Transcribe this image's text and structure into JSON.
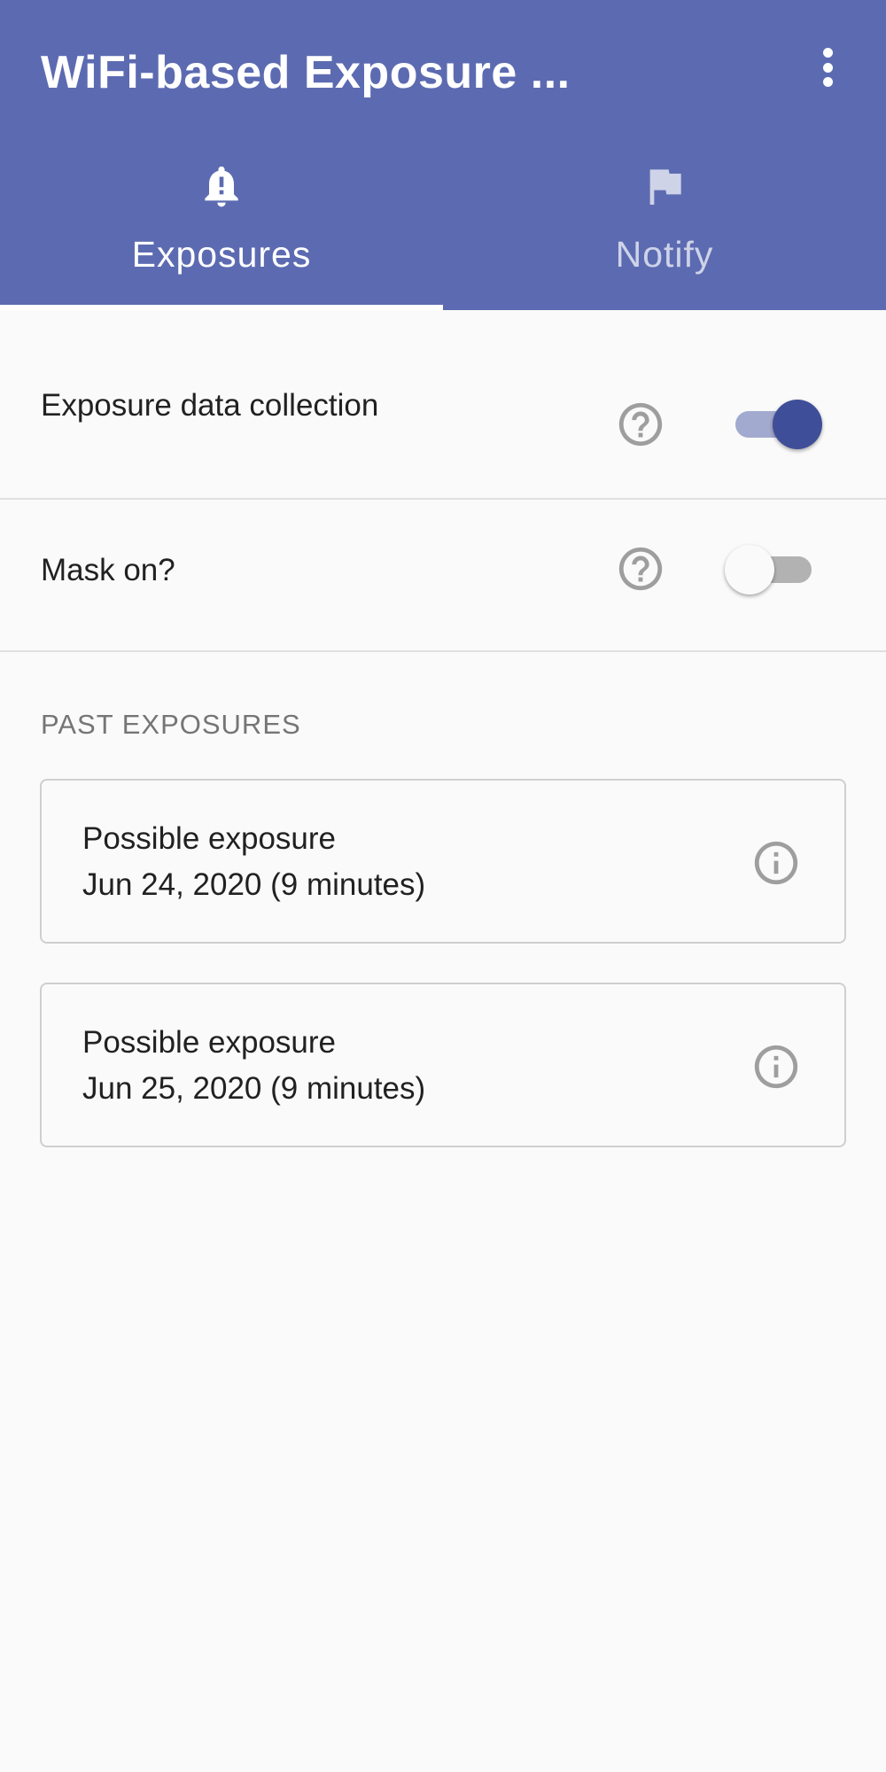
{
  "app_bar": {
    "title": "WiFi-based Exposure ...",
    "background_color": "#5c6bb1",
    "overflow_icon": "more-vert-icon"
  },
  "tabs": [
    {
      "label": "Exposures",
      "icon": "bell-alert-icon",
      "selected": true
    },
    {
      "label": "Notify",
      "icon": "flag-icon",
      "selected": false
    }
  ],
  "settings": {
    "collection": {
      "label": "Exposure data collection",
      "help_icon": "help-circle-icon",
      "enabled": true
    },
    "mask": {
      "label": "Mask on?",
      "help_icon": "help-circle-icon",
      "enabled": false
    }
  },
  "past_exposures": {
    "header": "PAST EXPOSURES",
    "items": [
      {
        "title": "Possible exposure",
        "date": "Jun 24, 2020 (9 minutes)",
        "icon": "info-icon"
      },
      {
        "title": "Possible exposure",
        "date": "Jun 25, 2020 (9 minutes)",
        "icon": "info-icon"
      }
    ]
  },
  "colors": {
    "accent": "#3f4e98",
    "accent_track": "#a3aacf",
    "page_background": "#fafafa"
  }
}
